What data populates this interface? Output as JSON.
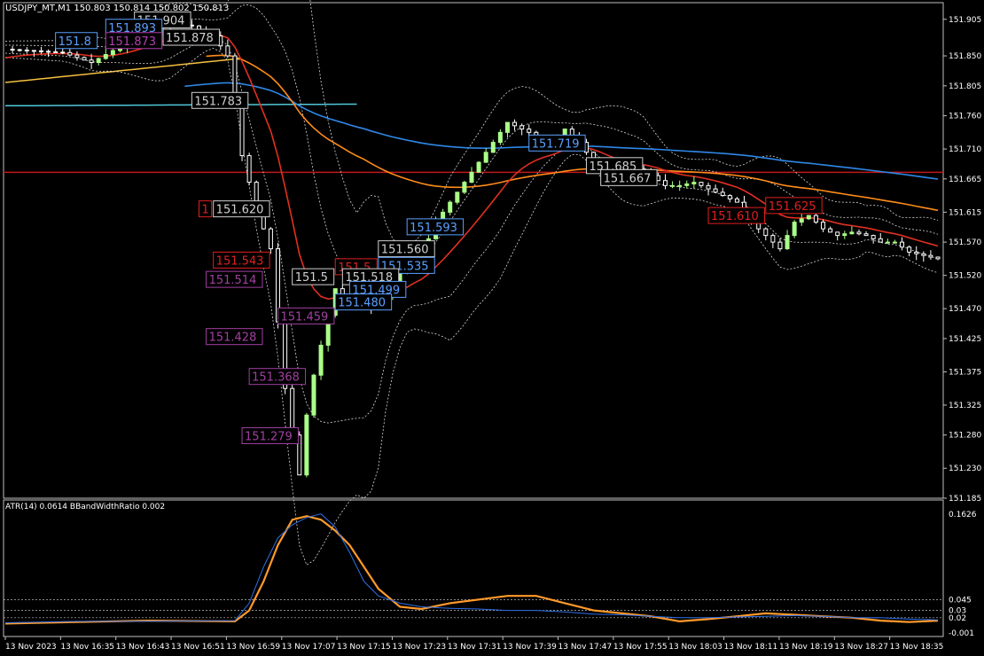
{
  "header": {
    "symbol": "USDJPY_MT,M1",
    "quote_values": [
      "150.803",
      "150.814",
      "150.802",
      "150.813"
    ]
  },
  "indicator_header": {
    "atr_label": "ATR(14) 0.0614",
    "bbwr_label": "BBandWidthRatio 0.002"
  },
  "colors": {
    "background": "#000000",
    "frame": "#c0c0c0",
    "candle_bull": "#aaff88",
    "candle_bear": "#ffffff",
    "ma_red": "#e03020",
    "ma_orange": "#ff8c1a",
    "ma_yellow": "#f5c040",
    "ma_blue": "#2f88e8",
    "ma_cyan": "#50c8d8",
    "hline_dark_red": "#c01818",
    "atr_orange": "#ff9a2a",
    "atr_blue": "#2f6fe8"
  },
  "chart_data": [
    {
      "type": "candlestick",
      "title": "USDJPY_MT,M1",
      "ylim": [
        151.185,
        151.93
      ],
      "y_ticks": [
        "151.905",
        "151.850",
        "151.805",
        "151.760",
        "151.710",
        "151.665",
        "151.615",
        "151.570",
        "151.520",
        "151.470",
        "151.425",
        "151.375",
        "151.325",
        "151.280",
        "151.230",
        "151.185"
      ],
      "y_tick_values": [
        151.905,
        151.85,
        151.805,
        151.76,
        151.71,
        151.665,
        151.615,
        151.57,
        151.52,
        151.47,
        151.425,
        151.375,
        151.325,
        151.28,
        151.23,
        151.185
      ],
      "x_ticks": [
        "13 Nov 2023",
        "13 Nov 16:35",
        "13 Nov 16:43",
        "13 Nov 16:51",
        "13 Nov 16:59",
        "13 Nov 17:07",
        "13 Nov 17:15",
        "13 Nov 17:23",
        "13 Nov 17:31",
        "13 Nov 17:39",
        "13 Nov 17:47",
        "13 Nov 17:55",
        "13 Nov 18:03",
        "13 Nov 18:11",
        "13 Nov 18:19",
        "13 Nov 18:27",
        "13 Nov 18:35"
      ],
      "price_path": [
        [
          0,
          151.86
        ],
        [
          8,
          151.855
        ],
        [
          12,
          151.84
        ],
        [
          17,
          151.87
        ],
        [
          22,
          151.9
        ],
        [
          26,
          151.895
        ],
        [
          29,
          151.88
        ],
        [
          31,
          151.85
        ],
        [
          33,
          151.7
        ],
        [
          35,
          151.62
        ],
        [
          37,
          151.56
        ],
        [
          38,
          151.45
        ],
        [
          39,
          151.35
        ],
        [
          40,
          151.28
        ],
        [
          41,
          151.22
        ],
        [
          42,
          151.31
        ],
        [
          43,
          151.37
        ],
        [
          45,
          151.46
        ],
        [
          46,
          151.5
        ],
        [
          48,
          151.48
        ],
        [
          50,
          151.52
        ],
        [
          51,
          151.47
        ],
        [
          53,
          151.49
        ],
        [
          55,
          151.53
        ],
        [
          57,
          151.55
        ],
        [
          58,
          151.55
        ],
        [
          60,
          151.6
        ],
        [
          62,
          151.63
        ],
        [
          64,
          151.66
        ],
        [
          66,
          151.69
        ],
        [
          68,
          151.72
        ],
        [
          70,
          151.75
        ],
        [
          72,
          151.74
        ],
        [
          74,
          151.73
        ],
        [
          76,
          151.72
        ],
        [
          78,
          151.74
        ],
        [
          80,
          151.72
        ],
        [
          82,
          151.69
        ],
        [
          84,
          151.67
        ],
        [
          86,
          151.665
        ],
        [
          88,
          151.68
        ],
        [
          90,
          151.67
        ],
        [
          92,
          151.655
        ],
        [
          94,
          151.655
        ],
        [
          96,
          151.66
        ],
        [
          98,
          151.65
        ],
        [
          100,
          151.64
        ],
        [
          102,
          151.63
        ],
        [
          104,
          151.6
        ],
        [
          106,
          151.58
        ],
        [
          108,
          151.56
        ],
        [
          110,
          151.6
        ],
        [
          112,
          151.61
        ],
        [
          114,
          151.59
        ],
        [
          116,
          151.58
        ],
        [
          118,
          151.585
        ],
        [
          120,
          151.58
        ],
        [
          122,
          151.57
        ],
        [
          124,
          151.57
        ],
        [
          126,
          151.555
        ],
        [
          128,
          151.55
        ],
        [
          130,
          151.545
        ]
      ],
      "price_labels": [
        {
          "text": "151.904",
          "value": 151.904,
          "bar": 18,
          "color": "#d0d0d0"
        },
        {
          "text": "151.893",
          "value": 151.893,
          "bar": 14,
          "color": "#5aa0ff"
        },
        {
          "text": "151.878",
          "value": 151.878,
          "bar": 22,
          "color": "#d0d0d0"
        },
        {
          "text": "151.873",
          "value": 151.873,
          "bar": 14,
          "color": "#b040b0"
        },
        {
          "text": "151.8",
          "value": 151.873,
          "bar": 7,
          "color": "#5aa0ff"
        },
        {
          "text": "151.783",
          "value": 151.783,
          "bar": 26,
          "color": "#d0d0d0"
        },
        {
          "text": "151.620",
          "value": 151.62,
          "bar": 29,
          "color": "#d0d0d0"
        },
        {
          "text": "1",
          "value": 151.62,
          "bar": 27,
          "color": "#e02020"
        },
        {
          "text": "151.543",
          "value": 151.543,
          "bar": 29,
          "color": "#e02020"
        },
        {
          "text": "151.514",
          "value": 151.514,
          "bar": 28,
          "color": "#a040a0"
        },
        {
          "text": "151.459",
          "value": 151.459,
          "bar": 38,
          "color": "#a040a0"
        },
        {
          "text": "151.428",
          "value": 151.428,
          "bar": 28,
          "color": "#a040a0"
        },
        {
          "text": "151.368",
          "value": 151.368,
          "bar": 34,
          "color": "#a040a0"
        },
        {
          "text": "151.279",
          "value": 151.279,
          "bar": 33,
          "color": "#a040a0"
        },
        {
          "text": "151.593",
          "value": 151.593,
          "bar": 56,
          "color": "#5aa0ff"
        },
        {
          "text": "151.560",
          "value": 151.56,
          "bar": 52,
          "color": "#d0d0d0"
        },
        {
          "text": "151.535",
          "value": 151.535,
          "bar": 52,
          "color": "#5aa0ff"
        },
        {
          "text": "151.5",
          "value": 151.533,
          "bar": 46,
          "color": "#e02020"
        },
        {
          "text": "151.5",
          "value": 151.518,
          "bar": 40,
          "color": "#d0d0d0"
        },
        {
          "text": "151.518",
          "value": 151.518,
          "bar": 47,
          "color": "#d0d0d0"
        },
        {
          "text": "151.499",
          "value": 151.499,
          "bar": 48,
          "color": "#5aa0ff"
        },
        {
          "text": "151.480",
          "value": 151.48,
          "bar": 46,
          "color": "#5aa0ff"
        },
        {
          "text": "151.719",
          "value": 151.719,
          "bar": 73,
          "color": "#5aa0ff"
        },
        {
          "text": "151.685",
          "value": 151.685,
          "bar": 81,
          "color": "#d0d0d0"
        },
        {
          "text": "151.667",
          "value": 151.667,
          "bar": 83,
          "color": "#d0d0d0"
        },
        {
          "text": "151.610",
          "value": 151.61,
          "bar": 98,
          "color": "#e02020"
        },
        {
          "text": "151.625",
          "value": 151.625,
          "bar": 106,
          "color": "#e02020"
        }
      ]
    },
    {
      "type": "line",
      "title": "ATR(14) 0.0614 BBandWidthRatio 0.002",
      "ylim": [
        -0.001,
        0.17
      ],
      "y_ticks": [
        "0.1626",
        "0.045",
        "0.03",
        "0.02",
        "-0.001"
      ],
      "y_tick_values": [
        0.1626,
        0.045,
        0.03,
        0.02,
        -0.001
      ],
      "series": [
        {
          "values": [
            [
              0,
              0.012
            ],
            [
              10,
              0.014
            ],
            [
              20,
              0.016
            ],
            [
              32,
              0.015
            ],
            [
              34,
              0.03
            ],
            [
              36,
              0.07
            ],
            [
              38,
              0.12
            ],
            [
              40,
              0.155
            ],
            [
              42,
              0.16
            ],
            [
              44,
              0.155
            ],
            [
              46,
              0.14
            ],
            [
              48,
              0.12
            ],
            [
              50,
              0.09
            ],
            [
              52,
              0.06
            ],
            [
              55,
              0.035
            ],
            [
              58,
              0.032
            ],
            [
              62,
              0.04
            ],
            [
              66,
              0.045
            ],
            [
              70,
              0.05
            ],
            [
              74,
              0.05
            ],
            [
              78,
              0.04
            ],
            [
              82,
              0.03
            ],
            [
              86,
              0.026
            ],
            [
              90,
              0.022
            ],
            [
              94,
              0.015
            ],
            [
              98,
              0.018
            ],
            [
              102,
              0.022
            ],
            [
              106,
              0.026
            ],
            [
              110,
              0.024
            ],
            [
              114,
              0.022
            ],
            [
              118,
              0.02
            ],
            [
              122,
              0.016
            ],
            [
              126,
              0.014
            ],
            [
              130,
              0.016
            ]
          ],
          "color": "#ff9a2a"
        },
        {
          "values": [
            [
              0,
              0.013
            ],
            [
              10,
              0.015
            ],
            [
              20,
              0.015
            ],
            [
              32,
              0.016
            ],
            [
              34,
              0.04
            ],
            [
              36,
              0.09
            ],
            [
              38,
              0.13
            ],
            [
              40,
              0.148
            ],
            [
              42,
              0.158
            ],
            [
              44,
              0.163
            ],
            [
              46,
              0.145
            ],
            [
              48,
              0.11
            ],
            [
              50,
              0.07
            ],
            [
              52,
              0.05
            ],
            [
              55,
              0.04
            ],
            [
              58,
              0.035
            ],
            [
              62,
              0.033
            ],
            [
              66,
              0.032
            ],
            [
              70,
              0.03
            ],
            [
              74,
              0.03
            ],
            [
              78,
              0.028
            ],
            [
              82,
              0.025
            ],
            [
              86,
              0.024
            ],
            [
              90,
              0.022
            ],
            [
              94,
              0.02
            ],
            [
              98,
              0.02
            ],
            [
              102,
              0.021
            ],
            [
              106,
              0.022
            ],
            [
              110,
              0.023
            ],
            [
              114,
              0.022
            ],
            [
              118,
              0.02
            ],
            [
              122,
              0.02
            ],
            [
              126,
              0.018
            ],
            [
              130,
              0.017
            ]
          ],
          "color": "#2f6fe8"
        }
      ]
    }
  ]
}
